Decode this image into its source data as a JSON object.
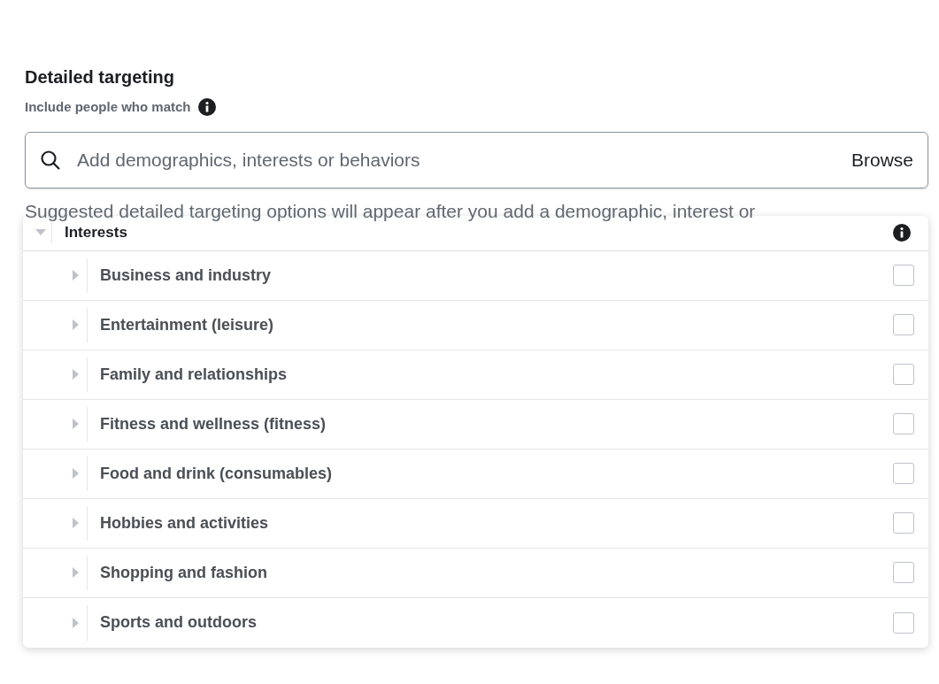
{
  "section": {
    "title": "Detailed targeting",
    "subtitle": "Include people who match"
  },
  "search": {
    "placeholder": "Add demographics, interests or behaviors",
    "browse": "Browse"
  },
  "hint": "Suggested detailed targeting options will appear after you add a demographic, interest or",
  "dropdown": {
    "header": {
      "label": "Interests",
      "expanded": true
    },
    "items": [
      {
        "label": "Business and industry",
        "expanded": false,
        "checked": false
      },
      {
        "label": "Entertainment (leisure)",
        "expanded": false,
        "checked": false
      },
      {
        "label": "Family and relationships",
        "expanded": false,
        "checked": false
      },
      {
        "label": "Fitness and wellness (fitness)",
        "expanded": false,
        "checked": false
      },
      {
        "label": "Food and drink (consumables)",
        "expanded": false,
        "checked": false
      },
      {
        "label": "Hobbies and activities",
        "expanded": false,
        "checked": false
      },
      {
        "label": "Shopping and fashion",
        "expanded": false,
        "checked": false
      },
      {
        "label": "Sports and outdoors",
        "expanded": false,
        "checked": false
      }
    ]
  }
}
